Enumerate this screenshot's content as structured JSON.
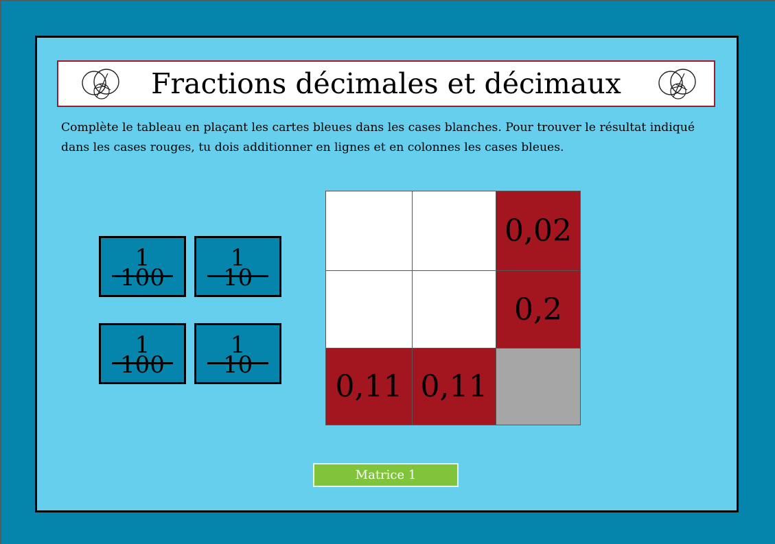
{
  "header": {
    "title": "Fractions décimales et décimaux"
  },
  "instructions": {
    "text": "Complète le tableau en plaçant les cartes bleues dans les cases blanches. Pour trouver le résultat indiqué dans les cases rouges, tu dois additionner en lignes et en colonnes les cases bleues."
  },
  "cards": [
    {
      "numerator": "1",
      "denominator": "100"
    },
    {
      "numerator": "1",
      "denominator": "10"
    },
    {
      "numerator": "1",
      "denominator": "100"
    },
    {
      "numerator": "1",
      "denominator": "10"
    }
  ],
  "grid": {
    "row_totals": [
      "0,02",
      "0,2"
    ],
    "column_totals": [
      "0,11",
      "0,11"
    ]
  },
  "footer": {
    "button_label": "Matrice  1"
  },
  "colors": {
    "background": "#0585ab",
    "panel": "#66cfee",
    "card": "#0585ab",
    "total_cell": "#a3161f",
    "empty_cell": "#ffffff",
    "corner_cell": "#a6a6a6",
    "button": "#7fc43b",
    "title_border": "#a3192a"
  },
  "icons": {
    "logo": "circles-sketch-logo"
  }
}
